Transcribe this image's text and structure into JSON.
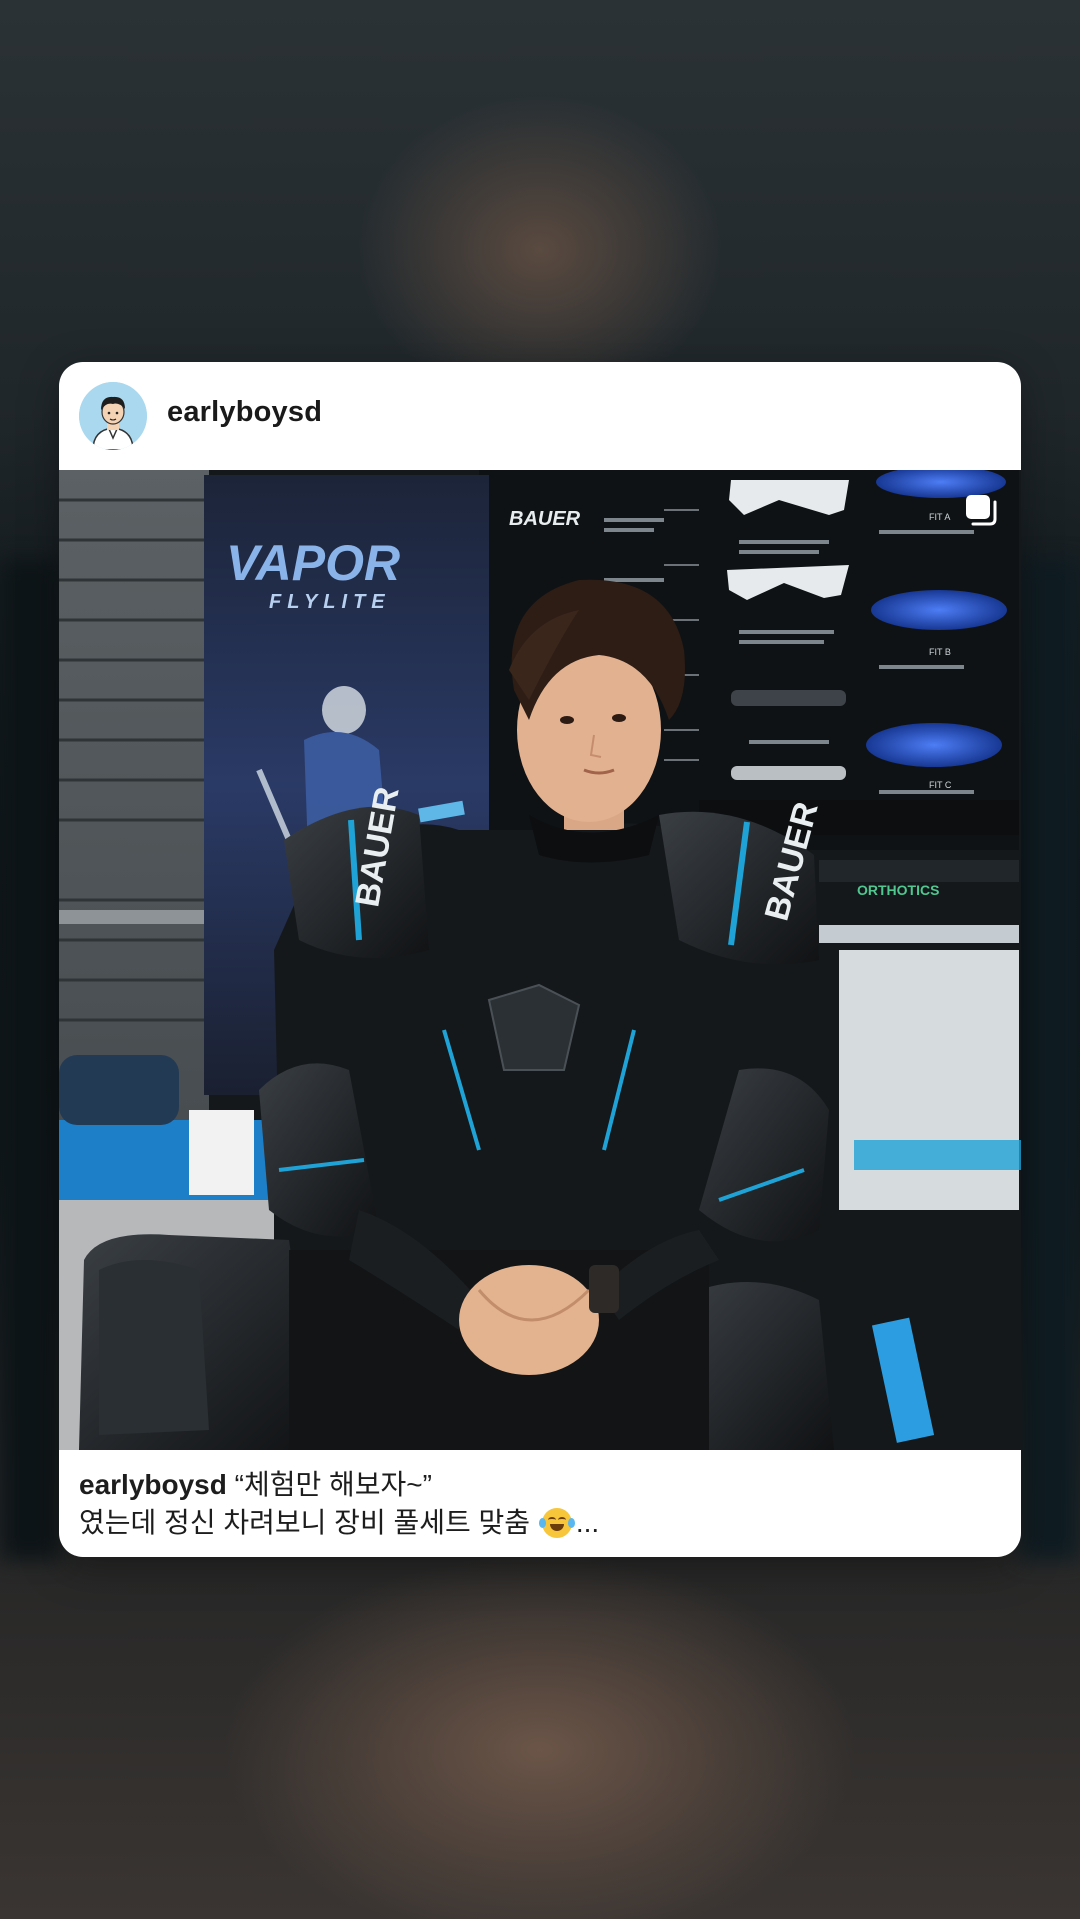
{
  "post": {
    "username": "earlyboysd",
    "caption_user": "earlyboysd",
    "caption_line1": " “체험만 해보자~”",
    "caption_line2": "였는데 정신 차려보니 장비 풀세트 맞춤 ",
    "caption_ellipsis": "...",
    "emoji": "tears-of-joy-emoji"
  },
  "photo_text": {
    "banner_title": "VAPOR",
    "banner_subtitle": "FLYLITE",
    "brand": "BAUER",
    "orthotics": "ORTHOTICS",
    "fit_a": "FIT A",
    "fit_b": "FIT B",
    "fit_c": "FIT C"
  },
  "icons": {
    "avatar": "cartoon-avatar",
    "multi_photo": "copy-icon"
  },
  "colors": {
    "card": "#ffffff",
    "text": "#1a1a1a",
    "accent_blue": "#1fa3d6"
  }
}
